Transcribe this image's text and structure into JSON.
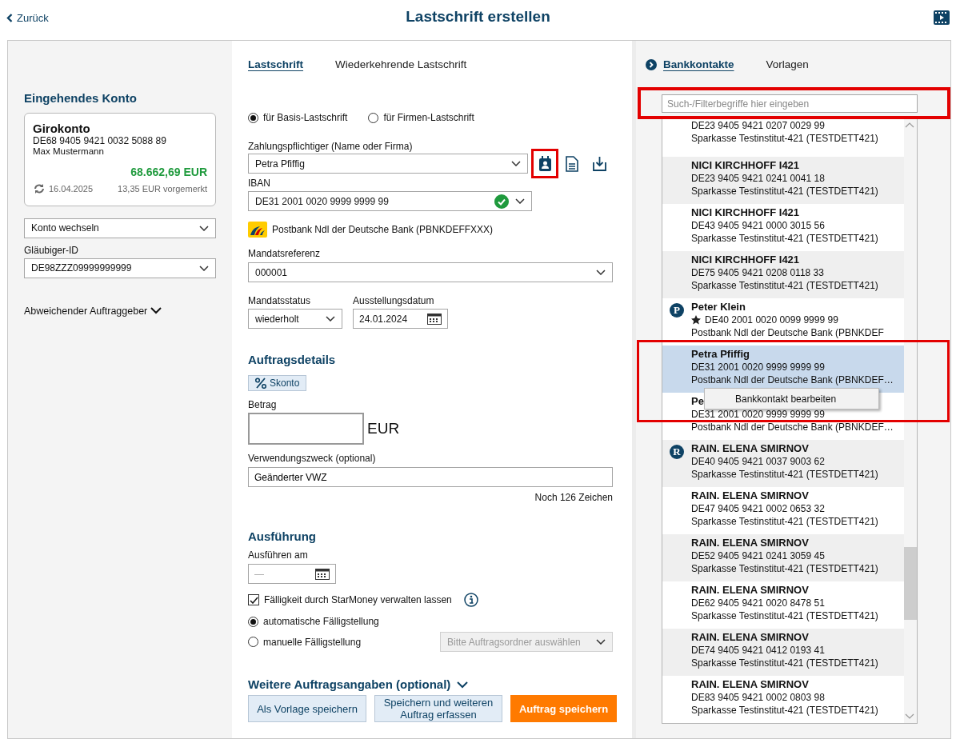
{
  "header": {
    "back": "Zurück",
    "title": "Lastschrift erstellen"
  },
  "account_panel": {
    "heading": "Eingehendes Konto",
    "account": {
      "name": "Girokonto",
      "iban": "DE68 9405 9421 0032 5088 89",
      "owner": "Max Mustermann",
      "balance": "68.662,69 EUR",
      "date": "16.04.2025",
      "pending": "13,35 EUR vorgemerkt"
    },
    "switch_select": "Konto wechseln",
    "creditor_label": "Gläubiger-ID",
    "creditor_value": "DE98ZZZ09999999999",
    "other_payer": "Abweichender Auftraggeber"
  },
  "form_tabs": [
    {
      "label": "Lastschrift",
      "selected": true
    },
    {
      "label": "Wiederkehrende Lastschrift",
      "selected": false
    }
  ],
  "form": {
    "debit_types": [
      {
        "label": "für Basis-Lastschrift",
        "selected": true
      },
      {
        "label": "für Firmen-Lastschrift",
        "selected": false
      }
    ],
    "payer_label": "Zahlungspflichtiger (Name oder Firma)",
    "payer_value": "Petra Pfiffig",
    "payer_tools": [
      {
        "kind": "contacts",
        "highlighted": true
      },
      {
        "kind": "document",
        "highlighted": false
      },
      {
        "kind": "import",
        "highlighted": false
      }
    ],
    "iban_label": "IBAN",
    "iban_value": "DE31 2001 0020 9999 9999 99",
    "iban_valid": true,
    "bank": "Postbank Ndl der Deutsche Bank",
    "bic": "(PBNKDEFFXXX)",
    "mandate_label": "Mandatsreferenz",
    "mandate_value": "000001",
    "mandate_status_label": "Mandatsstatus",
    "mandate_status_value": "wiederholt",
    "issue_date_label": "Ausstellungsdatum",
    "issue_date_value": "24.01.2024",
    "details_heading": "Auftragsdetails",
    "discount_button": "Skonto",
    "amount_label": "Betrag",
    "currency": "EUR",
    "purpose_label": "Verwendungszweck (optional)",
    "purpose_value": "Geänderter VWZ",
    "remaining": "Noch 126 Zeichen",
    "execution_heading": "Ausführung",
    "execute_label": "Ausführen am",
    "execute_placeholder": "—",
    "managed": {
      "label": "Fälligkeit durch StarMoney verwalten lassen",
      "checked": true
    },
    "due_options": [
      {
        "label": "automatische Fälligstellung",
        "selected": true
      },
      {
        "label": "manuelle Fälligstellung",
        "selected": false
      }
    ],
    "folder_select": {
      "placeholder": "Bitte Auftragsordner auswählen",
      "disabled": true
    },
    "more_heading": "Weitere Auftragsangaben (optional)"
  },
  "actions": [
    {
      "label": "Als Vorlage speichern",
      "kind": "secondary"
    },
    {
      "label": "Speichern und weiteren Auftrag erfassen",
      "kind": "secondary"
    },
    {
      "label": "Auftrag speichern",
      "kind": "primary"
    }
  ],
  "contact_tabs": [
    {
      "label": "Bankkontakte",
      "selected": true
    },
    {
      "label": "Vorlagen",
      "selected": false
    }
  ],
  "search": {
    "placeholder": "Such-/Filterbegriffe hier eingeben",
    "highlighted": true
  },
  "contacts": [
    {
      "iban": "DE23 9405 9421 0207 0029 99",
      "bank": "Sparkasse Testinstitut-421 (TESTDETT421)",
      "selected": false,
      "highlighted": false
    },
    {
      "name": "NICI KIRCHHOFF I421",
      "iban": "DE23 9405 9421 0241 0041 18",
      "bank": "Sparkasse Testinstitut-421 (TESTDETT421)",
      "selected": false,
      "highlighted": false
    },
    {
      "name": "NICI KIRCHHOFF I421",
      "iban": "DE43 9405 9421 0000 3015 56",
      "bank": "Sparkasse Testinstitut-421 (TESTDETT421)",
      "selected": false,
      "highlighted": false
    },
    {
      "name": "NICI KIRCHHOFF I421",
      "iban": "DE75 9405 9421 0208 0118 33",
      "bank": "Sparkasse Testinstitut-421 (TESTDETT421)",
      "selected": false,
      "highlighted": false
    },
    {
      "name": "Peter Klein",
      "badge": "P",
      "starred": true,
      "iban": "DE40 2001 0020 0099 9999 99",
      "bank": "Postbank Ndl der Deutsche Bank (PBNKDEF",
      "selected": false,
      "highlighted": false
    },
    {
      "name": "Petra Pfiffig",
      "iban": "DE31 2001 0020 9999 9999 99",
      "bank": "Postbank Ndl der Deutsche Bank (PBNKDEF…",
      "selected": true,
      "highlighted": true
    },
    {
      "name": "Pe",
      "iban": "DE31 2001 0020 9999 9999 99",
      "bank": "Postbank Ndl der Deutsche Bank (PBNKDEF…",
      "selected": false,
      "highlighted": false
    },
    {
      "name": "RAIN. ELENA SMIRNOV",
      "badge": "R",
      "iban": "DE40 9405 9421 0037 9003 62",
      "bank": "Sparkasse Testinstitut-421 (TESTDETT421)",
      "selected": false,
      "highlighted": false
    },
    {
      "name": "RAIN. ELENA SMIRNOV",
      "iban": "DE47 9405 9421 0002 0653 32",
      "bank": "Sparkasse Testinstitut-421 (TESTDETT421)",
      "selected": false,
      "highlighted": false
    },
    {
      "name": "RAIN. ELENA SMIRNOV",
      "iban": "DE52 9405 9421 0241 3059 45",
      "bank": "Sparkasse Testinstitut-421 (TESTDETT421)",
      "selected": false,
      "highlighted": false
    },
    {
      "name": "RAIN. ELENA SMIRNOV",
      "iban": "DE62 9405 9421 0020 8478 51",
      "bank": "Sparkasse Testinstitut-421 (TESTDETT421)",
      "selected": false,
      "highlighted": false
    },
    {
      "name": "RAIN. ELENA SMIRNOV",
      "iban": "DE74 9405 9421 0412 0193 41",
      "bank": "Sparkasse Testinstitut-421 (TESTDETT421)",
      "selected": false,
      "highlighted": false
    },
    {
      "name": "RAIN. ELENA SMIRNOV",
      "iban": "DE83 9405 9421 0002 0803 98",
      "bank": "Sparkasse Testinstitut-421 (TESTDETT421)",
      "selected": false,
      "highlighted": false
    }
  ],
  "context_menu": {
    "items": [
      "Bankkontakt bearbeiten"
    ]
  }
}
